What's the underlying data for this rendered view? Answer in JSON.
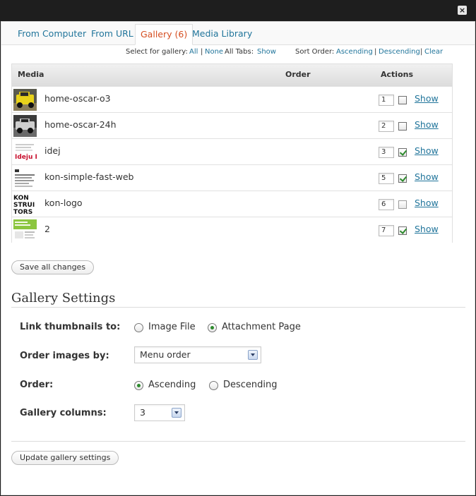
{
  "window": {
    "close_symbol": "×"
  },
  "tabs": [
    {
      "label": "From Computer",
      "active": false
    },
    {
      "label": "From URL",
      "active": false
    },
    {
      "label": "Gallery (6)",
      "active": true
    },
    {
      "label": "Media Library",
      "active": false
    }
  ],
  "filter": {
    "select_label": "Select for gallery:",
    "all": "All",
    "sep1": "|",
    "none": "None",
    "all_tabs_label": "All Tabs:",
    "show": "Show",
    "sort_label": "Sort Order:",
    "ascending": "Ascending",
    "sep2": "|",
    "descending": "Descending",
    "sep3": "|",
    "clear": "Clear"
  },
  "table": {
    "columns": {
      "media": "Media",
      "order": "Order",
      "actions": "Actions"
    },
    "rows": [
      {
        "title": "home-oscar-o3",
        "order": "1",
        "checked": false,
        "thumb": "yellow-car",
        "action": "Show"
      },
      {
        "title": "home-oscar-24h",
        "order": "2",
        "checked": false,
        "thumb": "grey-car",
        "action": "Show"
      },
      {
        "title": "idej",
        "order": "3",
        "checked": true,
        "thumb": "text-ideju",
        "action": "Show"
      },
      {
        "title": "kon-simple-fast-web",
        "order": "5",
        "checked": true,
        "thumb": "text-page",
        "action": "Show"
      },
      {
        "title": "kon-logo",
        "order": "6",
        "checked": false,
        "thumb": "kon-logo",
        "action": "Show"
      },
      {
        "title": "2",
        "order": "7",
        "checked": true,
        "thumb": "green-page",
        "action": "Show"
      }
    ],
    "thumb_text": {
      "ideju": "Ideju I",
      "kon_logo": "KON\nSTRUI\nTORS"
    }
  },
  "save_all_label": "Save all changes",
  "gallery_settings": {
    "title": "Gallery Settings",
    "link_label": "Link thumbnails to:",
    "link_options": [
      "Image File",
      "Attachment Page"
    ],
    "link_selected": "Attachment Page",
    "order_by_label": "Order images by:",
    "order_by_value": "Menu order",
    "order_label": "Order:",
    "order_options": [
      "Ascending",
      "Descending"
    ],
    "order_selected": "Ascending",
    "columns_label": "Gallery columns:",
    "columns_value": "3",
    "update_label": "Update gallery settings"
  },
  "colors": {
    "link": "#21759b",
    "active_tab": "#d54e21",
    "check": "#2d8a2d"
  }
}
